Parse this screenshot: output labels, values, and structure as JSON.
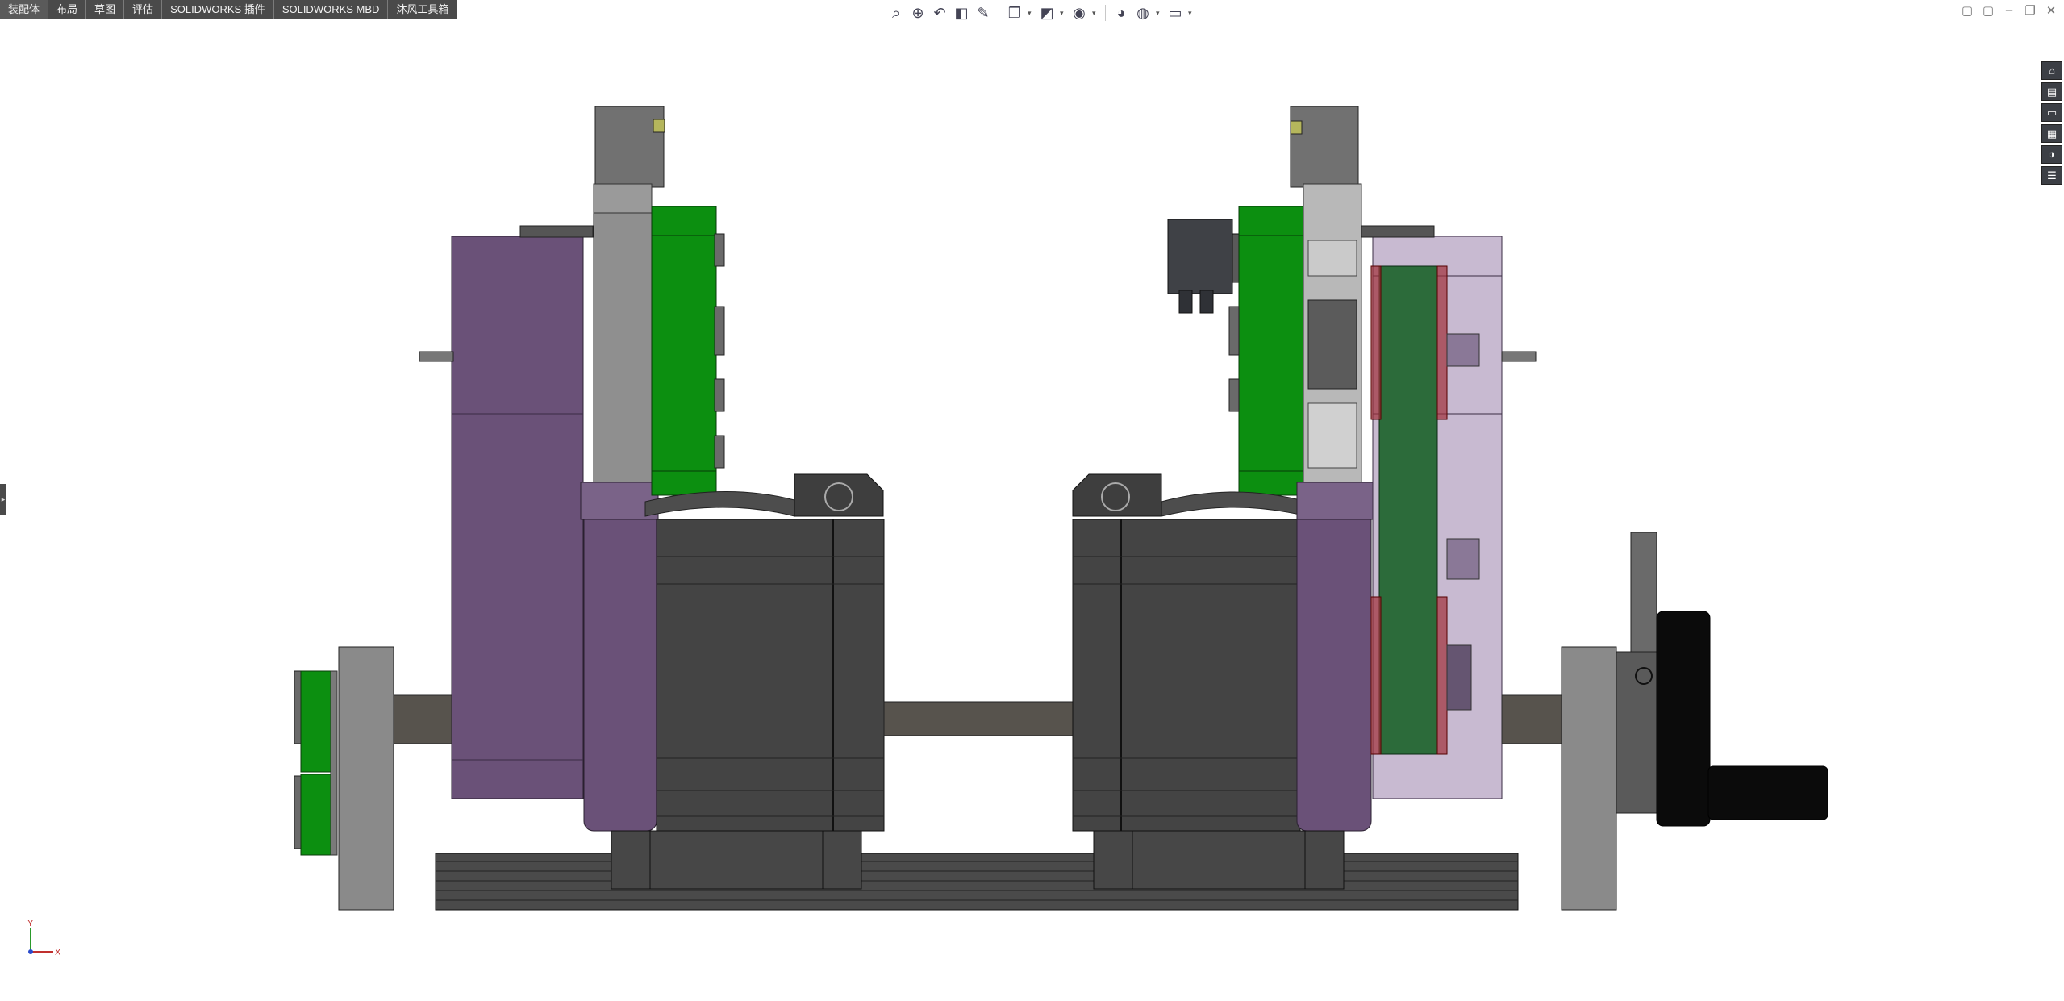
{
  "tabs": [
    "装配体",
    "布局",
    "草图",
    "评估",
    "SOLIDWORKS 插件",
    "SOLIDWORKS MBD",
    "沐风工具箱"
  ],
  "active_tab_index": 0,
  "hud_icons": [
    {
      "name": "zoom-to-fit-icon",
      "glyph": "⌕",
      "dropdown": false
    },
    {
      "name": "zoom-to-area-icon",
      "glyph": "⊕",
      "dropdown": false
    },
    {
      "name": "previous-view-icon",
      "glyph": "↶",
      "dropdown": false
    },
    {
      "name": "section-view-icon",
      "glyph": "◧",
      "dropdown": false
    },
    {
      "name": "dynamic-annotation-icon",
      "glyph": "✎",
      "dropdown": false
    },
    {
      "name": "view-orientation-icon",
      "glyph": "❒",
      "dropdown": true
    },
    {
      "name": "display-style-icon",
      "glyph": "◩",
      "dropdown": true
    },
    {
      "name": "hide-show-items-icon",
      "glyph": "◉",
      "dropdown": true
    },
    {
      "name": "edit-appearance-icon",
      "glyph": "◕",
      "dropdown": false
    },
    {
      "name": "apply-scene-icon",
      "glyph": "◍",
      "dropdown": true
    },
    {
      "name": "view-settings-icon",
      "glyph": "▭",
      "dropdown": true
    }
  ],
  "window_controls": [
    {
      "name": "viewport-tile-left-icon",
      "glyph": "▢"
    },
    {
      "name": "viewport-tile-right-icon",
      "glyph": "▢"
    },
    {
      "name": "minimize-icon",
      "glyph": "–"
    },
    {
      "name": "restore-icon",
      "glyph": "❐"
    },
    {
      "name": "close-icon",
      "glyph": "✕"
    }
  ],
  "task_pane": [
    {
      "name": "home-icon",
      "glyph": "⌂"
    },
    {
      "name": "design-library-icon",
      "glyph": "▤"
    },
    {
      "name": "file-explorer-icon",
      "glyph": "▭"
    },
    {
      "name": "view-palette-icon",
      "glyph": "▦"
    },
    {
      "name": "appearances-icon",
      "glyph": "◑"
    },
    {
      "name": "custom-properties-icon",
      "glyph": "☰"
    }
  ],
  "triad": {
    "x_label": "X",
    "y_label": "Y"
  },
  "colors": {
    "purple": "#6a5178",
    "purple_light": "#b6a3c2",
    "green": "#0c8f10",
    "green_dark": "#2c6b3a",
    "dark_gray": "#454545",
    "mid_gray": "#6e6e6e",
    "light_gray": "#8e8e8e",
    "shaft": "#57534d",
    "black": "#0c0c0c"
  }
}
